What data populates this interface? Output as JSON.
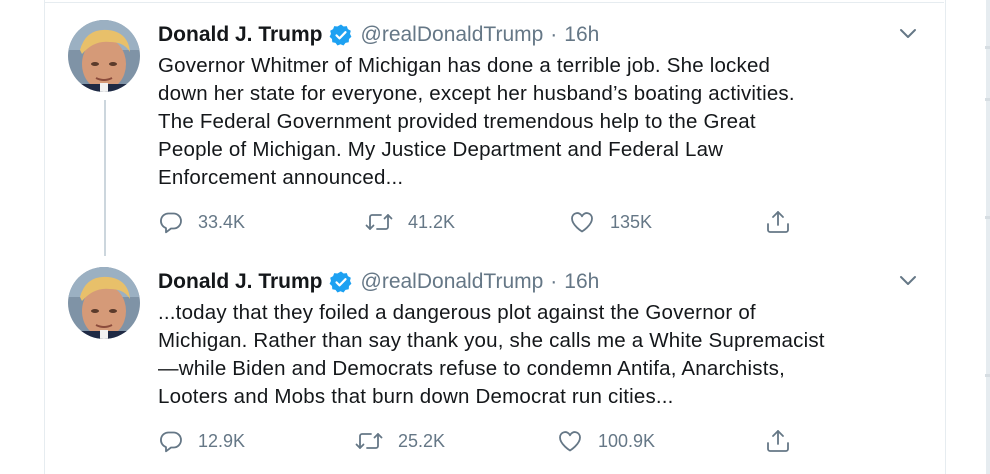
{
  "tweets": [
    {
      "display_name": "Donald J. Trump",
      "handle": "@realDonaldTrump",
      "separator": "·",
      "time": "16h",
      "body_lines": [
        "Governor Whitmer of Michigan has done a terrible job. She locked",
        "down her state for everyone, except her husband’s boating activities.",
        "The Federal Government provided tremendous help to the Great",
        "People of Michigan. My Justice Department and Federal Law",
        "Enforcement announced..."
      ],
      "replies": "33.4K",
      "retweets": "41.2K",
      "likes": "135K"
    },
    {
      "display_name": "Donald J. Trump",
      "handle": "@realDonaldTrump",
      "separator": "·",
      "time": "16h",
      "body_lines": [
        "...today that they foiled a dangerous plot against the Governor of",
        "Michigan. Rather than say thank you, she calls me a White Supremacist",
        "—while Biden and Democrats refuse to condemn Antifa, Anarchists,",
        "Looters and Mobs that burn down Democrat run cities..."
      ],
      "replies": "12.9K",
      "retweets": "25.2K",
      "likes": "100.9K"
    }
  ],
  "icons": {
    "verified": "verified-badge-icon",
    "caret": "chevron-down-icon",
    "reply": "reply-icon",
    "retweet": "retweet-icon",
    "like": "heart-icon",
    "share": "share-icon"
  },
  "colors": {
    "text_primary": "#14171a",
    "text_secondary": "#657786",
    "verified_blue": "#1da1f2",
    "divider": "#e6ecf0",
    "thread_line": "#ccd6dd"
  }
}
